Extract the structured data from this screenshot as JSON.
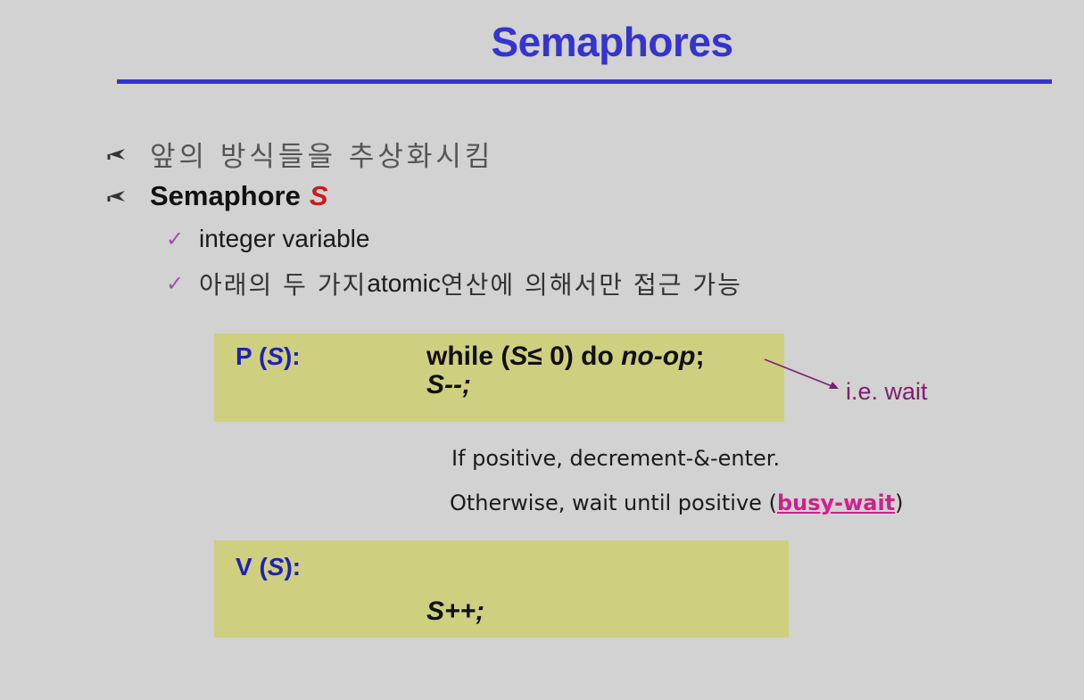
{
  "slide": {
    "title": "Semaphores",
    "bullets": [
      {
        "text": "앞의 방식들을 추상화시킴"
      },
      {
        "text": "Semaphore",
        "emphasis": "S"
      }
    ],
    "subbullets": [
      {
        "text": "integer variable"
      },
      {
        "text_ko_1": "아래의 두 가지 ",
        "text_en": "atomic",
        "text_ko_2": " 연산에 의해서만 접근 가능"
      }
    ],
    "p_block": {
      "label_pre": "P (",
      "label_var": "S",
      "label_post": "):",
      "line1_pre": "while (",
      "line1_var": "S",
      "line1_mid": "≤ 0) do ",
      "line1_em": "no-op",
      "line1_end": ";",
      "line2": "S--;"
    },
    "annotation": "i.e. wait",
    "explanation": {
      "line1": "If positive, decrement-&-enter.",
      "line2_pre": "Otherwise, wait until positive (",
      "line2_link": "busy-wait",
      "line2_post": ")"
    },
    "v_block": {
      "label_pre": "V (",
      "label_var": "S",
      "label_post": "):",
      "line1": "S++;"
    }
  },
  "colors": {
    "background": "#d2d2d2",
    "title": "#3434d0",
    "box": "#cfcf80",
    "label": "#2020b8",
    "emphasis_red": "#cc1a1a",
    "check": "#a050a8",
    "annotation": "#7a2070",
    "busy_wait": "#d0208a"
  }
}
